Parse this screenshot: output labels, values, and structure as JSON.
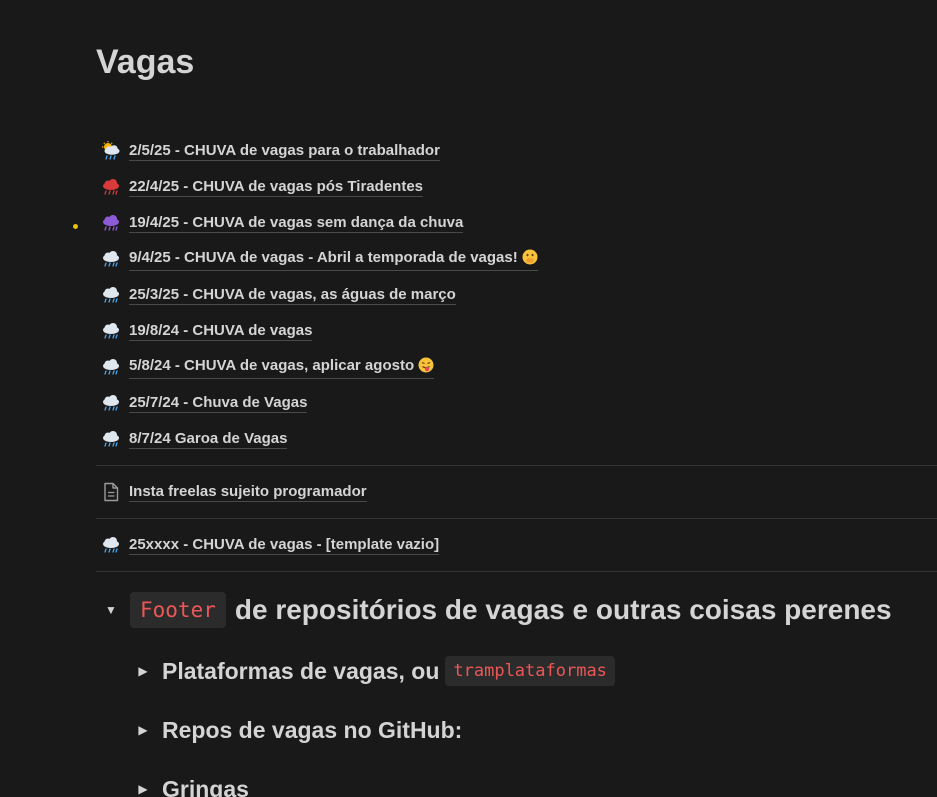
{
  "page": {
    "title": "Vagas"
  },
  "links": [
    {
      "icon": "sun-behind-rain-cloud-icon",
      "label": "2/5/25 - CHUVA de vagas para o trabalhador"
    },
    {
      "icon": "red-rain-cloud-icon",
      "label": "22/4/25 - CHUVA de vagas pós Tiradentes"
    },
    {
      "icon": "purple-rain-cloud-icon",
      "label": "19/4/25 - CHUVA de vagas sem dança da chuva"
    },
    {
      "icon": "rain-cloud-icon",
      "label": "9/4/25 - CHUVA de vagas - Abril a temporada de vagas!",
      "trailing_emoji": "hand-over-mouth-emoji"
    },
    {
      "icon": "rain-cloud-icon",
      "label": "25/3/25 - CHUVA de vagas, as águas de março"
    },
    {
      "icon": "rain-cloud-icon",
      "label": "19/8/24 - CHUVA de vagas"
    },
    {
      "icon": "rain-cloud-icon",
      "label": "5/8/24 - CHUVA de vagas, aplicar agosto",
      "trailing_emoji": "tongue-out-emoji"
    },
    {
      "icon": "rain-cloud-icon",
      "label": "25/7/24 - Chuva de Vagas"
    },
    {
      "icon": "rain-cloud-icon",
      "label": "8/7/24 Garoa de Vagas"
    }
  ],
  "extra_links": {
    "freelas": {
      "icon": "document-icon",
      "label": "Insta freelas sujeito programador"
    },
    "template": {
      "icon": "rain-cloud-icon",
      "label": "25xxxx - CHUVA de vagas - [template vazio]"
    }
  },
  "footer_toggle": {
    "code": "Footer",
    "text": "de repositórios de vagas e outras coisas perenes",
    "expanded": true
  },
  "sub_toggles": [
    {
      "text": "Plataformas de vagas, ou",
      "code": "tramplataformas"
    },
    {
      "text": "Repos de vagas no GitHub:"
    },
    {
      "text": "Gringas"
    }
  ],
  "colors": {
    "background": "#191919",
    "text": "#d4d4d4",
    "code_text": "#eb5757",
    "code_bg": "#2b2b2b",
    "divider": "#343434",
    "dot": "#e6c200"
  }
}
